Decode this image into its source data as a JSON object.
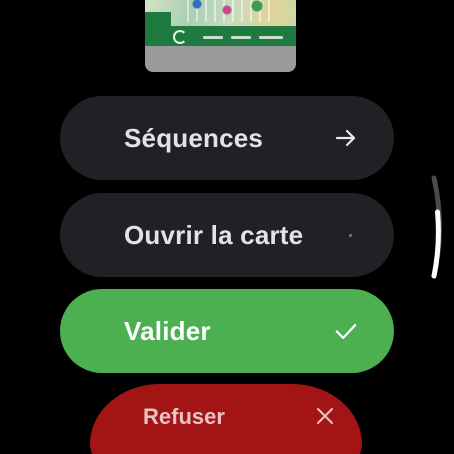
{
  "buttons": {
    "sequences_label": "Séquences",
    "open_map_label": "Ouvrir la carte",
    "validate_label": "Valider",
    "refuse_label": "Refuser"
  },
  "icons": {
    "sequences": "arrow-right-icon",
    "validate": "check-icon",
    "refuse": "close-icon"
  },
  "colors": {
    "background": "#000000",
    "chip": "#202124",
    "validate": "#4caf50",
    "refuse": "#a31515",
    "text": "#e2e3e5"
  }
}
